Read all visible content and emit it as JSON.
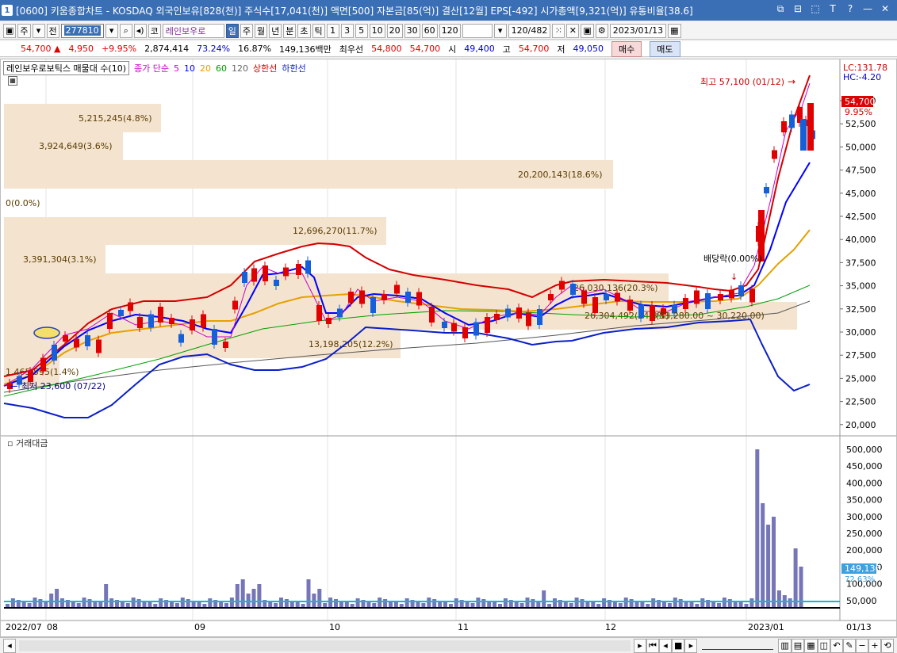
{
  "window": {
    "badge": "1",
    "title": "[0600] 키움종합차트 - KOSDAQ 외국인보유[828(천)] 주식수[17,041(천)] 액면[500] 자본금[85(억)] 결산[12월] EPS[-492] 시가총액[9,321(억)] 유통비율[38.6]",
    "controls": [
      "⧉",
      "⊟",
      "⬚",
      "T",
      "?",
      "—",
      "✕"
    ]
  },
  "toolbar": {
    "code_prefix": "주",
    "period_prefix": "전",
    "code": "277810",
    "name_label": "코",
    "stock_name": "레인보우로",
    "periods": [
      "일",
      "주",
      "월",
      "년",
      "분",
      "초",
      "틱"
    ],
    "active_period": "일",
    "intervals": [
      "1",
      "3",
      "5",
      "10",
      "20",
      "30",
      "60",
      "120"
    ],
    "count": "120",
    "total": "/482",
    "date": "2023/01/13"
  },
  "quote": {
    "price": "54,700",
    "change": "4,950",
    "change_pct": "+9.95%",
    "volume": "2,874,414",
    "vol_ratio": "73.24%",
    "turnover": "16.87%",
    "amount": "149,136백만",
    "label_fix": "최우선",
    "ask": "54,800",
    "bid": "54,700",
    "open_label": "시",
    "open": "49,400",
    "high_label": "고",
    "high": "54,700",
    "low_label": "저",
    "low": "49,050",
    "buy_label": "매수",
    "sell_label": "매도"
  },
  "legend": {
    "name": "레인보우로보틱스 매물대 수(10)",
    "ma_label": "종가 단순",
    "ma5": "5",
    "ma10": "10",
    "ma20": "20",
    "ma60": "60",
    "ma120": "120",
    "upper": "상한선",
    "lower": "하한선",
    "colors": {
      "ma5": "#cc00cc",
      "ma10": "#0000ff",
      "ma20": "#e6a000",
      "ma60": "#009900",
      "ma120": "#666666",
      "upper": "#d40000",
      "lower": "#0a1fc8"
    }
  },
  "right_info": {
    "lc": "LC:131.78",
    "hc": "HC:-4.20"
  },
  "price_axis": [
    "55,000",
    "52,500",
    "50,000",
    "47,500",
    "45,000",
    "42,500",
    "40,000",
    "37,500",
    "35,000",
    "32,500",
    "30,000",
    "27,500",
    "25,000",
    "22,500",
    "20,000"
  ],
  "price_tag": {
    "value": "54,700",
    "pct": "9.95%"
  },
  "volume_profile": [
    {
      "label": "5,215,245(4.8%)"
    },
    {
      "label": "3,924,649(3.6%)"
    },
    {
      "label": "20,200,143(18.6%)"
    },
    {
      "label": "0(0.0%)"
    },
    {
      "label": "12,696,270(11.7%)"
    },
    {
      "label": "3,391,304(3.1%)"
    },
    {
      "label": "26,030,136(20.3%)"
    },
    {
      "label": "26,304,492(24.3%)"
    },
    {
      "label": "13,198,205(12.2%)"
    },
    {
      "label": "1,465,595(1.4%)"
    }
  ],
  "annotations": {
    "high": "최고 57,100 (01/12)",
    "low": "최저 23,600 (07/22)",
    "dividend": "배당락(0.00%)",
    "range": "(33,280.00 ~ 30,220.00)"
  },
  "sub_panel": {
    "title": "거래대금",
    "axis": [
      "500,000",
      "450,000",
      "400,000",
      "350,000",
      "300,000",
      "250,000",
      "200,000",
      "150,000",
      "100,000",
      "50,000"
    ],
    "value_tag": "149,136",
    "pct_tag": "72.63%"
  },
  "x_axis": [
    "2022/07",
    "08",
    "09",
    "10",
    "11",
    "12",
    "2023/01",
    "01/13"
  ]
}
